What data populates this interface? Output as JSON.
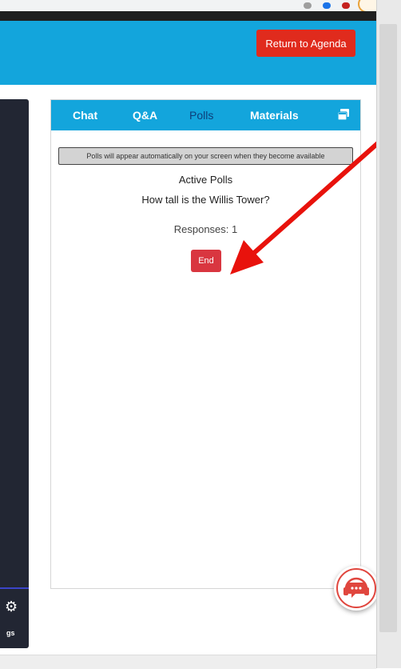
{
  "header": {
    "return_label": "Return to Agenda"
  },
  "left_panel": {
    "settings_label": "gs"
  },
  "tabs": [
    {
      "label": "Chat"
    },
    {
      "label": "Q&A"
    },
    {
      "label": "Polls"
    },
    {
      "label": "Materials"
    }
  ],
  "active_tab": "Polls",
  "polls": {
    "notice": "Polls will appear automatically on your screen when they become available",
    "active_title": "Active Polls",
    "question": "How tall is the Willis Tower?",
    "responses": "Responses: 1",
    "end_label": "End"
  },
  "icons": {
    "tab_extra": "popout-icon",
    "support": "support-chat-icon",
    "settings": "gear-icon"
  },
  "colors": {
    "brand_blue": "#13a5dc",
    "return_red": "#e02b1d",
    "end_red": "#d93640",
    "active_tab_text": "#0d3f7a",
    "annotation_arrow": "#e8120c"
  }
}
